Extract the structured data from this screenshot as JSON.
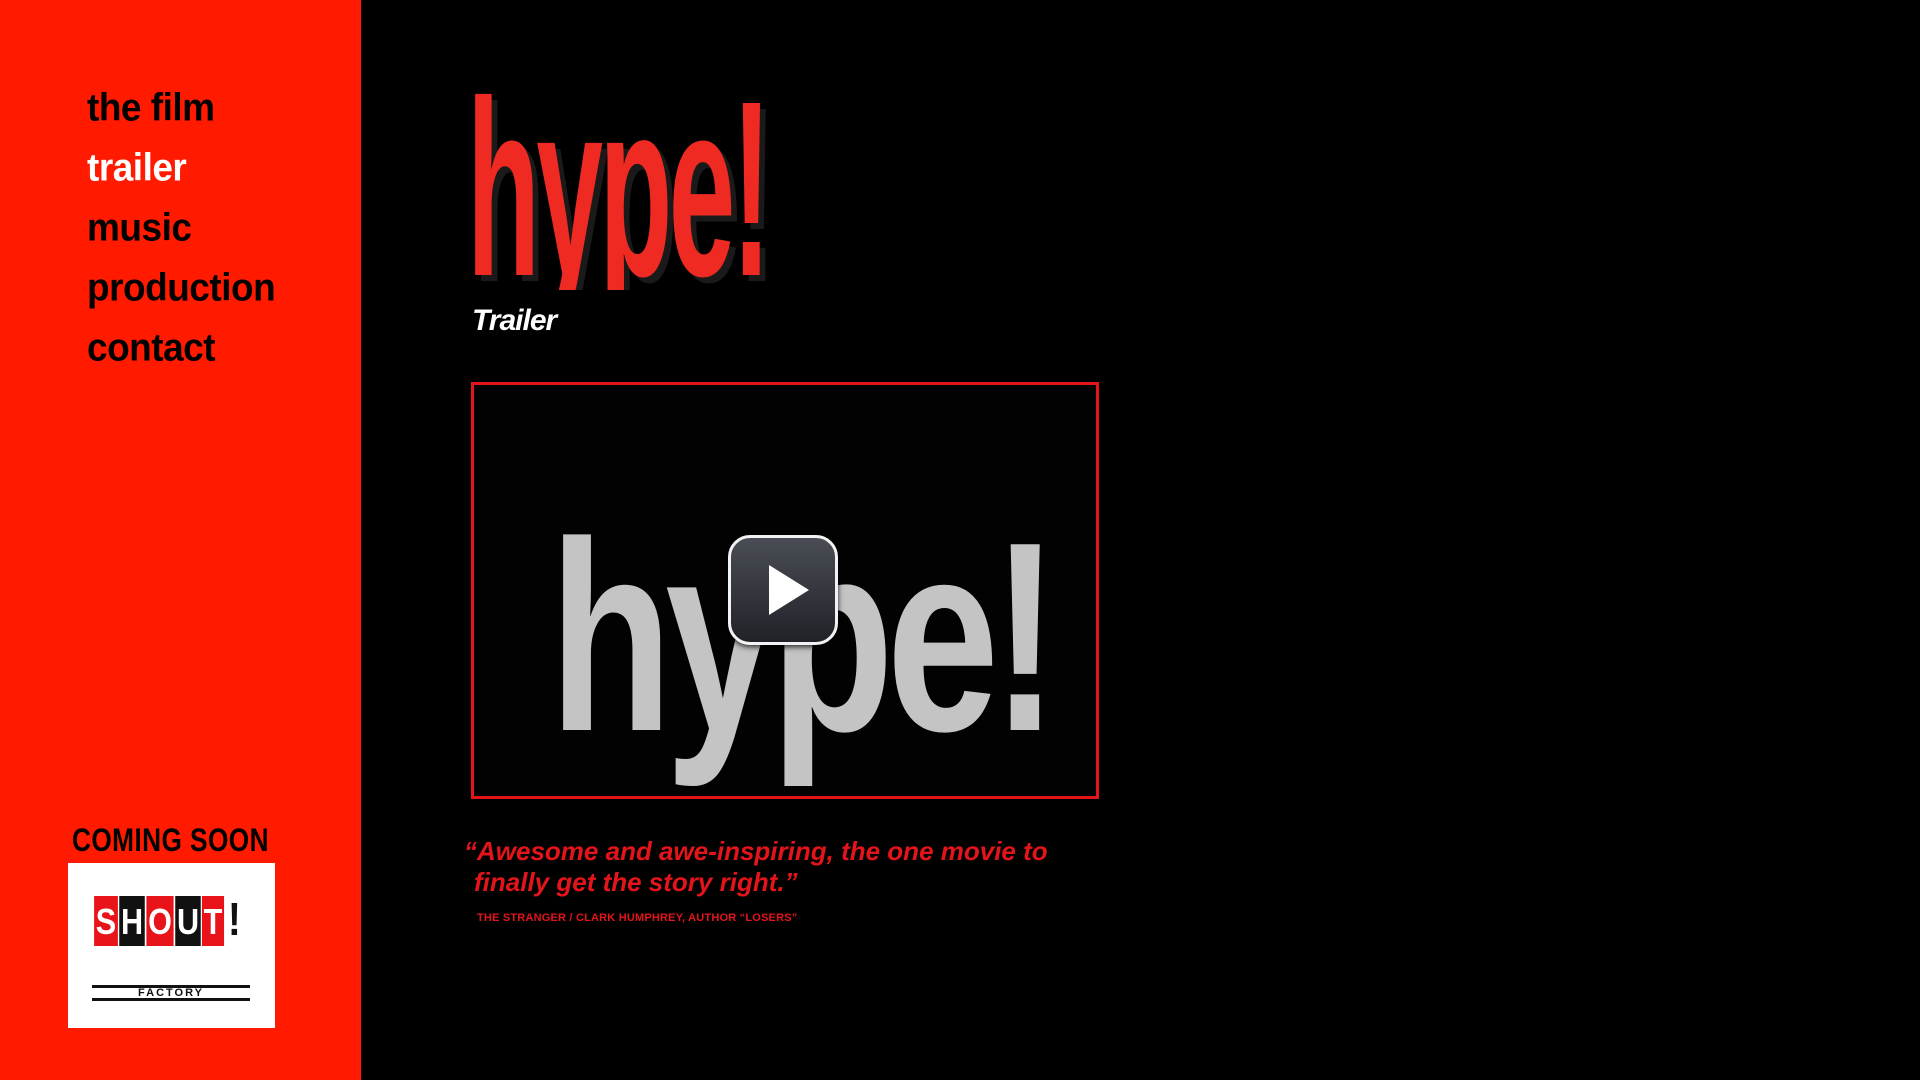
{
  "nav": {
    "items": [
      {
        "label": "the film"
      },
      {
        "label": "trailer"
      },
      {
        "label": "music"
      },
      {
        "label": "production"
      },
      {
        "label": "contact"
      }
    ],
    "active": "trailer"
  },
  "promo": {
    "coming_soon": "COMING SOON",
    "brand_letters": [
      "S",
      "H",
      "O",
      "U",
      "T",
      "!"
    ],
    "brand_subtitle": "FACTORY"
  },
  "logo": {
    "text": "hype!"
  },
  "page": {
    "title": "Trailer"
  },
  "video": {
    "poster_text": "hype!"
  },
  "quote": {
    "line1": "“Awesome and awe-inspiring, the one movie to",
    "line2": "finally get the story right.”",
    "attribution": "THE STRANGER / CLARK HUMPHREY, AUTHOR “LOSERS”"
  },
  "colors": {
    "sidebar": "#ff1a00",
    "accent_red": "#e3141a",
    "background": "#000000",
    "poster_gray": "#c4c4c4"
  }
}
